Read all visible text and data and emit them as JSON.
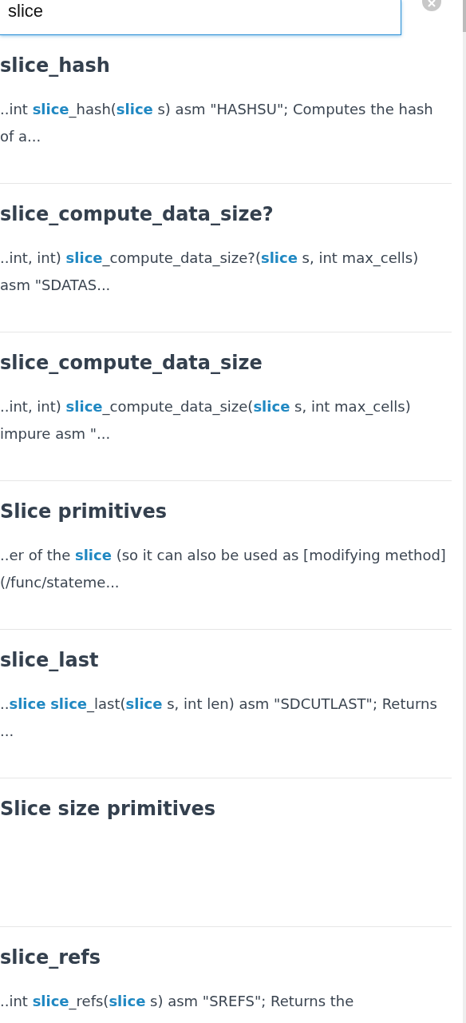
{
  "search": {
    "value": "slice"
  },
  "results": [
    {
      "title": "slice_hash",
      "snippet": "..int **slice**_hash(**slice** s) asm \"HASHSU\"; Computes the hash of a..."
    },
    {
      "title": "slice_compute_data_size?",
      "snippet": "..int, int) **slice**_compute_data_size?(**slice** s, int max_cells) asm \"SDATAS..."
    },
    {
      "title": "slice_compute_data_size",
      "snippet": "..int, int) **slice**_compute_data_size(**slice** s, int max_cells) impure asm \"..."
    },
    {
      "title": "Slice primitives",
      "snippet": "..er of the **slice** (so it can also be used as [modifying method](/func/stateme..."
    },
    {
      "title": "slice_last",
      "snippet": "..**slice** **slice**_last(**slice** s, int len) asm \"SDCUTLAST\"; Returns ..."
    },
    {
      "title": "Slice size primitives"
    },
    {
      "title": "slice_refs",
      "snippet": "..int **slice**_refs(**slice** s) asm \"SREFS\"; Returns the"
    }
  ]
}
